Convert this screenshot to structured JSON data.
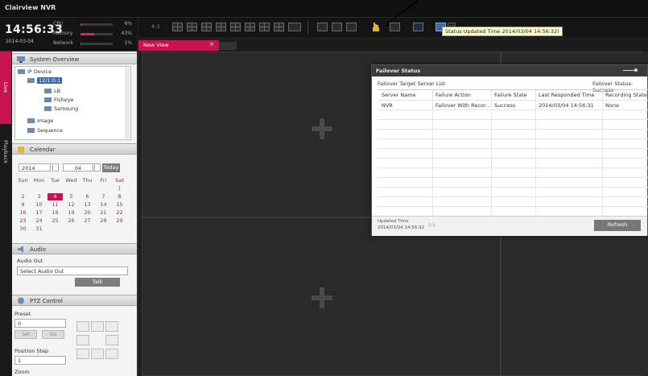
{
  "app": {
    "title": "Clairview NVR"
  },
  "status": {
    "time": "14:56:33",
    "date": "2014-03-04",
    "cpu": {
      "label": "CPU",
      "percent": "6%",
      "level": 0.06
    },
    "memory": {
      "label": "Memory",
      "percent": "43%",
      "level": 0.43
    },
    "network": {
      "label": "Network",
      "percent": "1%",
      "level": 0.01
    }
  },
  "toolbar": {
    "layout_label": "4:3",
    "tooltip": "Status Updated Time 2014/03/04 14:56:32)"
  },
  "tabs": [
    {
      "label": "New View",
      "close": "×"
    }
  ],
  "side_tabs": {
    "live": "Live",
    "playback": "Playback"
  },
  "system_overview": {
    "title": "System Overview",
    "tree": {
      "root": "IP Device",
      "device": "12/1:0:1",
      "children": [
        "LB",
        "Fisheye",
        "Samsung"
      ],
      "image": "Image",
      "sequence": "Sequence"
    }
  },
  "calendar": {
    "title": "Calendar",
    "year": "2014",
    "month": "04",
    "today_button": "Today",
    "weekdays": [
      "Sun",
      "Mon",
      "Tue",
      "Wed",
      "Thu",
      "Fri",
      "Sat"
    ],
    "days": [
      "2",
      "3",
      "4",
      "5",
      "6",
      "7",
      "8",
      "9",
      "10",
      "11",
      "12",
      "13",
      "14",
      "15",
      "16",
      "17",
      "18",
      "19",
      "20",
      "21",
      "22",
      "23",
      "24",
      "25",
      "26",
      "27",
      "28",
      "29",
      "30",
      "31"
    ],
    "today": "4",
    "next_month_days": [
      "1"
    ]
  },
  "audio": {
    "title": "Audio",
    "out_label": "Audio Out",
    "select_value": "Select Audio Out",
    "talk_button": "Talk"
  },
  "ptz": {
    "title": "PTZ Control",
    "preset_label": "Preset",
    "preset_value": "0",
    "set_button": "Set",
    "goto_button": "Go",
    "position_step_label": "Position Step",
    "position_step_value": "1",
    "zoom_label": "Zoom"
  },
  "failover": {
    "title": "Failover Status",
    "target_label": "Failover Target Server List",
    "status_label": "Failover Status: Success",
    "columns": [
      "Server Name",
      "Failure Action",
      "Failure State",
      "Last Responded Time",
      "Recording State"
    ],
    "rows": [
      [
        "NVR",
        "Failover With Recor...",
        "Success",
        "2014/03/04 14:56:31",
        "None"
      ]
    ],
    "updated_label": "Updated Time",
    "updated_value": "2014/03/04 14:56:32",
    "pager": "1/1",
    "refresh_button": "Refresh"
  },
  "colors": {
    "accent": "#c8144e",
    "background": "#2a2a2a",
    "toolbar": "#141414"
  }
}
